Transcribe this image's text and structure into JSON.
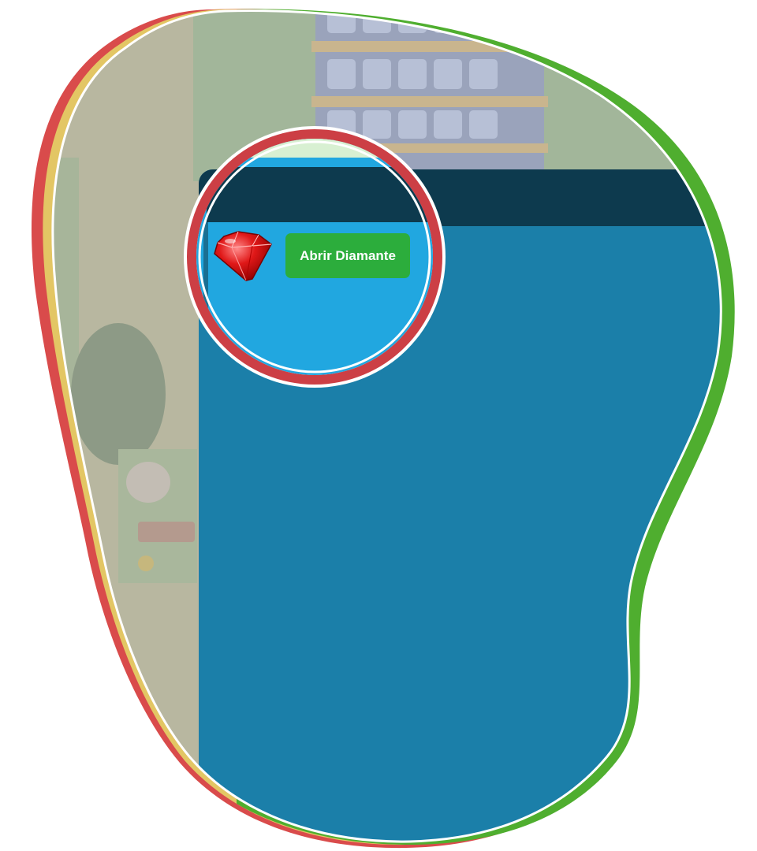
{
  "game": {
    "open_diamond_button_label": "Abrir Diamante",
    "game_scene": {
      "description_icon": "ruby-icon"
    }
  },
  "colors": {
    "panel_blue": "#1b7fa9",
    "panel_header": "#0d3a4e",
    "zoom_panel_blue": "#21a7e0",
    "button_green": "#2cad3c",
    "border_red": "#d94b4b",
    "border_yellow": "#e3c664",
    "border_green": "#4fae2f",
    "zoom_ring": "#cc3f45"
  }
}
